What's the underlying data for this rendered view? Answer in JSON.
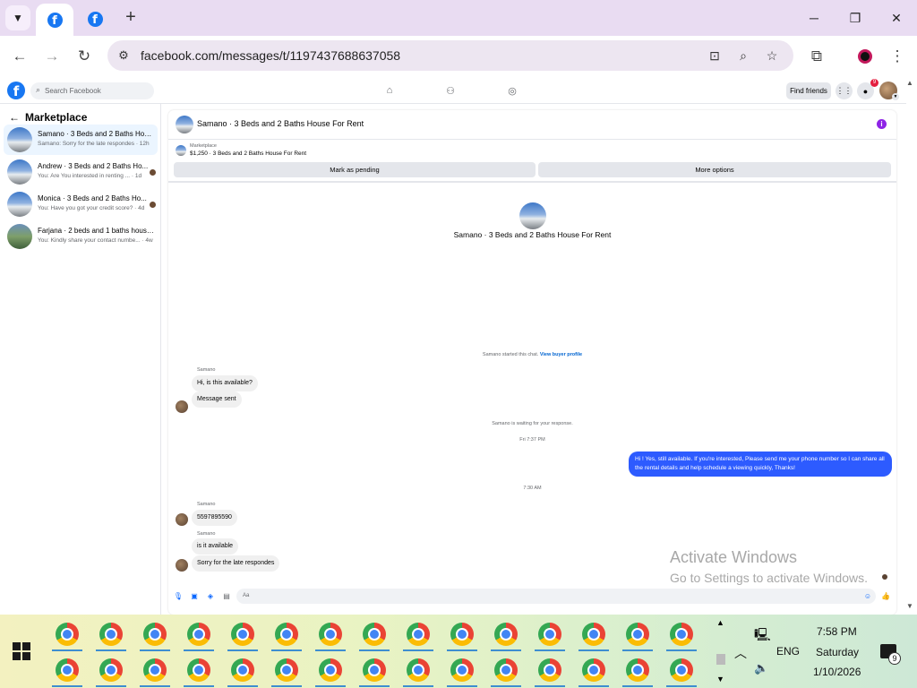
{
  "browser": {
    "url": "facebook.com/messages/t/1197437688637058"
  },
  "fb": {
    "search_placeholder": "Search Facebook",
    "find_friends": "Find friends",
    "notification_count": "9"
  },
  "sidebar": {
    "title": "Marketplace",
    "conversations": [
      {
        "name": "Samano · 3 Beds and 2 Baths Hous...",
        "preview": "Samano: Sorry for the late respondes · 12h"
      },
      {
        "name": "Andrew · 3 Beds and 2 Baths Ho...",
        "preview": "You: Are You interested in renting ... · 1d"
      },
      {
        "name": "Monica · 3 Beds and 2 Baths Ho...",
        "preview": "You: Have you got your credit score? · 4d"
      },
      {
        "name": "Farjana · 2 beds and 1 baths house...",
        "preview": "You: Kindly share your contact numbe... · 4w"
      }
    ]
  },
  "chat": {
    "header_name": "Samano · 3 Beds and 2 Baths House For Rent",
    "listing_label": "Marketplace",
    "listing_price": "$1,250 · 3 Beds and 2 Baths House For Rent",
    "mark_pending": "Mark as pending",
    "more_options": "More options",
    "intro_name": "Samano · 3 Beds and 2 Baths House For Rent",
    "started_text": "Samano started this chat.",
    "view_profile": "View buyer profile",
    "sender_name": "Samano",
    "msg1": "Hi, is this available?",
    "msg2": "Message sent",
    "waiting": "Samano is waiting for your response.",
    "time1": "Fri 7:37 PM",
    "out_msg": "Hi ! Yes, still available. If you're interested, Please send me your phone number so I can share all the rental details and help schedule a viewing quickly, Thanks!",
    "time2": "7:30 AM",
    "msg3": "5597895590",
    "msg4": "is it available",
    "msg5": "Sorry for the late respondes",
    "composer_placeholder": "Aa"
  },
  "watermark": {
    "line1": "Activate Windows",
    "line2": "Go to Settings to activate Windows."
  },
  "taskbar": {
    "language": "ENG",
    "time": "7:58 PM",
    "day": "Saturday",
    "date": "1/10/2026",
    "notification_count": "9"
  }
}
